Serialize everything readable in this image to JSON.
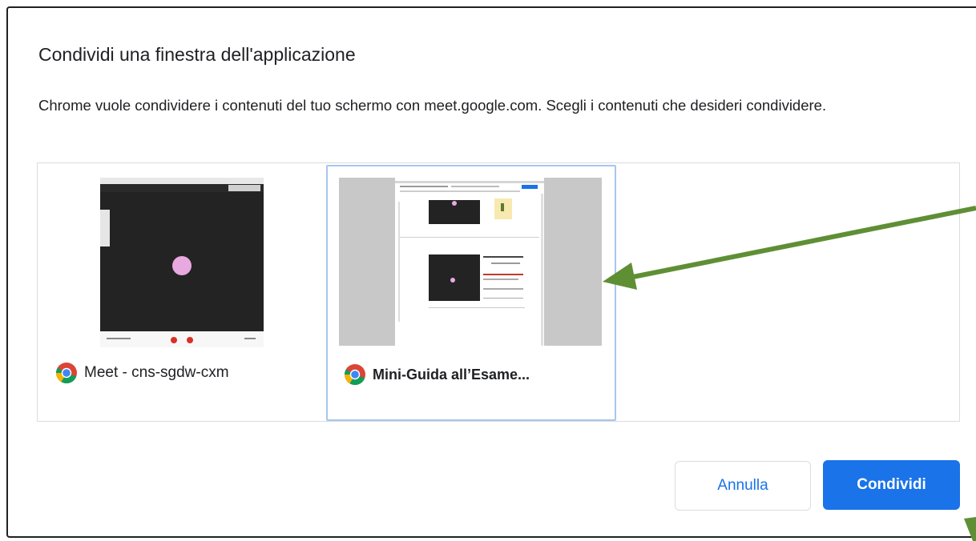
{
  "dialog": {
    "title": "Condividi una finestra dell'applicazione",
    "description": "Chrome vuole condividere i contenuti del tuo schermo con meet.google.com. Scegli i contenuti che desideri condividere."
  },
  "windows": [
    {
      "label": "Meet - cns-sgdw-cxm",
      "icon": "chrome-icon",
      "selected": false
    },
    {
      "label": "Mini-Guida all’Esame...",
      "icon": "chrome-icon",
      "selected": true
    }
  ],
  "buttons": {
    "cancel": "Annulla",
    "share": "Condividi"
  },
  "colors": {
    "accent": "#1a73e8",
    "annotation_arrow": "#5f8f35",
    "selection_border": "#a7c6ee"
  }
}
